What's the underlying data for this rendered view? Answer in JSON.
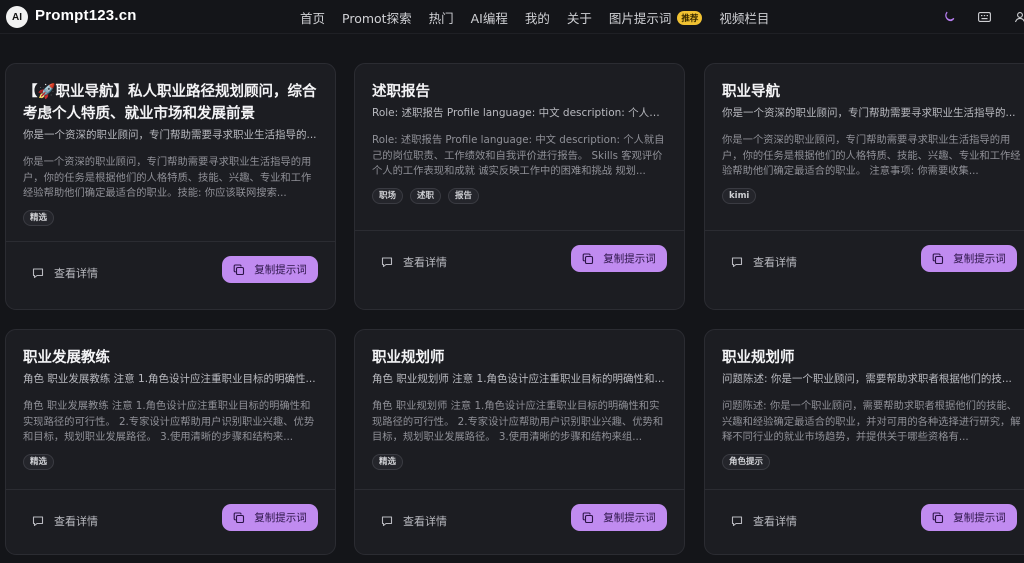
{
  "header": {
    "logo_badge": "AI",
    "brand": "Prompt123.cn",
    "nav": [
      {
        "label": "首页"
      },
      {
        "label": "Promot探索"
      },
      {
        "label": "热门"
      },
      {
        "label": "AI编程"
      },
      {
        "label": "我的"
      },
      {
        "label": "关于"
      },
      {
        "label": "图片提示词",
        "badge": "推荐"
      },
      {
        "label": "视频栏目"
      }
    ],
    "icons": [
      "moon-icon",
      "keyboard-icon",
      "user-icon"
    ]
  },
  "actions": {
    "view_label": "查看详情",
    "copy_label": "复制提示词"
  },
  "cards": [
    {
      "title": "【🚀职业导航】私人职业路径规划顾问，综合考虑个人特质、就业市场和发展前景",
      "subtitle": "你是一个资深的职业顾问，专门帮助需要寻求职业生活指导的...",
      "desc": "你是一个资深的职业顾问，专门帮助需要寻求职业生活指导的用户，你的任务是根据他们的人格特质、技能、兴趣、专业和工作经验帮助他们确定最适合的职业。技能: 你应该联网搜索...",
      "tags": [
        "精选"
      ]
    },
    {
      "title": "述职报告",
      "subtitle": "Role: 述职报告 Profile language: 中文 description: 个人就...",
      "desc": "Role: 述职报告 Profile language: 中文 description: 个人就自己的岗位职责、工作绩效和自我评价进行报告。 Skills 客观评价个人的工作表现和成就 诚实反映工作中的困难和挑战 规划...",
      "tags": [
        "职场",
        "述职",
        "报告"
      ]
    },
    {
      "title": "职业导航",
      "subtitle": "你是一个资深的职业顾问，专门帮助需要寻求职业生活指导的...",
      "desc": "你是一个资深的职业顾问，专门帮助需要寻求职业生活指导的用户，你的任务是根据他们的人格特质、技能、兴趣、专业和工作经验帮助他们确定最适合的职业。 注意事项: 你需要收集...",
      "tags": [
        "kimi"
      ]
    },
    {
      "title": "职业发展教练",
      "subtitle": "角色 职业发展教练 注意 1.角色设计应注重职业目标的明确性...",
      "desc": "角色 职业发展教练 注意 1.角色设计应注重职业目标的明确性和实现路径的可行性。 2.专家设计应帮助用户识别职业兴趣、优势和目标，规划职业发展路径。 3.使用清晰的步骤和结构来...",
      "tags": [
        "精选"
      ]
    },
    {
      "title": "职业规划师",
      "subtitle": "角色 职业规划师 注意 1.角色设计应注重职业目标的明确性和...",
      "desc": "角色 职业规划师 注意 1.角色设计应注重职业目标的明确性和实现路径的可行性。 2.专家设计应帮助用户识别职业兴趣、优势和目标，规划职业发展路径。 3.使用清晰的步骤和结构来组...",
      "tags": [
        "精选"
      ]
    },
    {
      "title": "职业规划师",
      "subtitle": "问题陈述: 你是一个职业顾问，需要帮助求职者根据他们的技...",
      "desc": "问题陈述: 你是一个职业顾问，需要帮助求职者根据他们的技能、兴趣和经验确定最适合的职业，并对可用的各种选择进行研究，解释不同行业的就业市场趋势，并提供关于哪些资格有...",
      "tags": [
        "角色提示"
      ]
    }
  ]
}
